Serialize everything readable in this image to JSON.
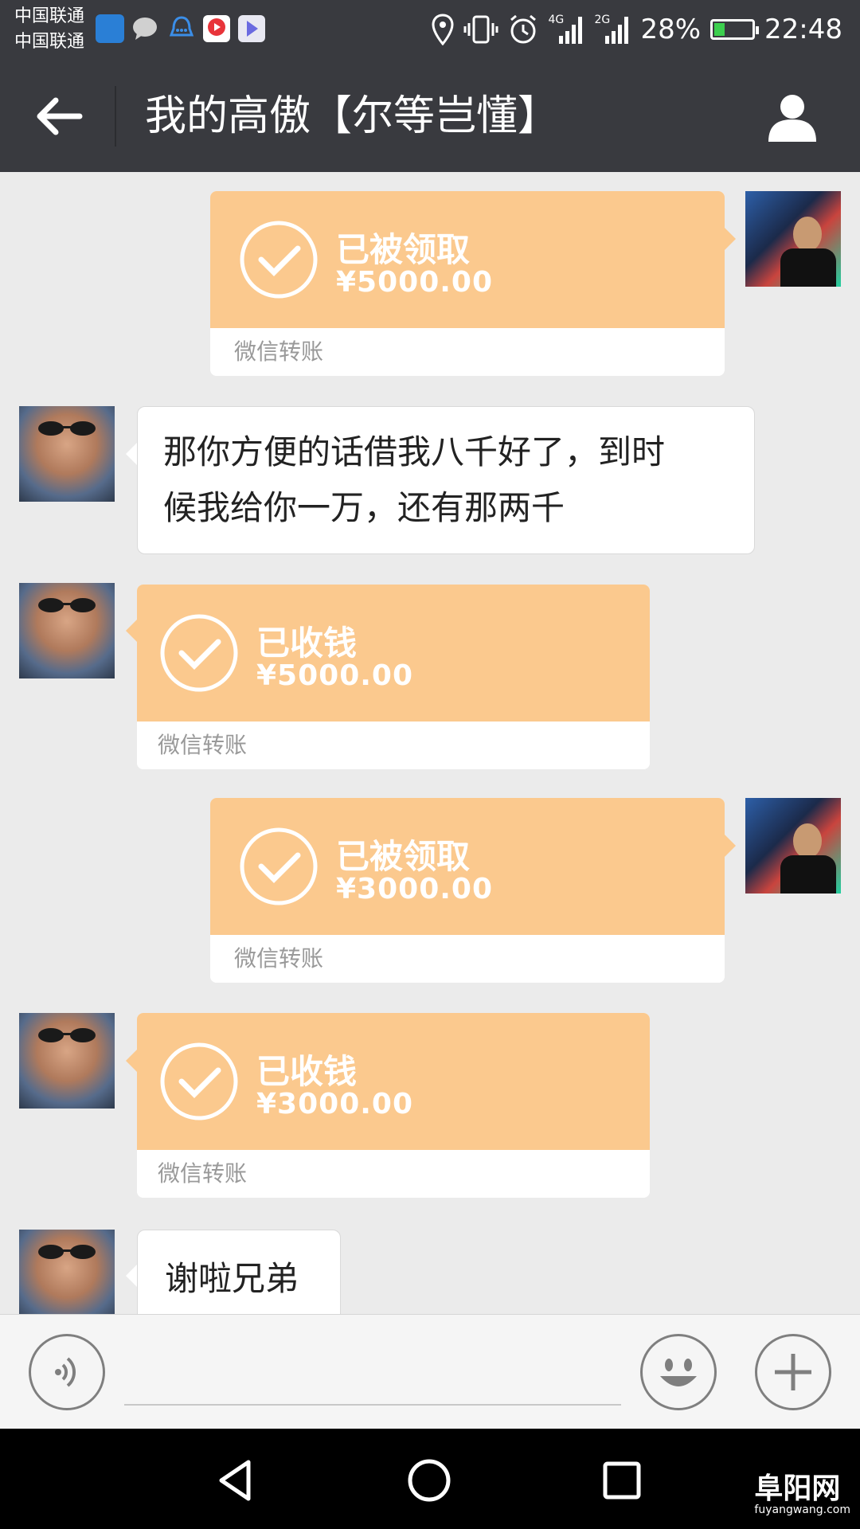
{
  "status_bar": {
    "carrier_1": "中国联通",
    "carrier_2": "中国联通",
    "battery_level": 0.28,
    "battery_text": "28%",
    "network_1": "4G",
    "network_2": "2G",
    "time": "22:48",
    "icons": [
      "weather-app-icon",
      "message-bubble-icon",
      "qq-bell-icon",
      "video-app-icon",
      "video-app-2-icon",
      "location-icon",
      "vibrate-icon",
      "alarm-icon",
      "signal-4g-icon",
      "signal-2g-icon",
      "battery-icon"
    ]
  },
  "header": {
    "title": "我的高傲【尔等岂懂】",
    "back_icon": "arrow-left-icon",
    "profile_icon": "person-icon"
  },
  "messages": [
    {
      "sender": "self",
      "type": "transfer",
      "status": "已被领取",
      "amount": "¥5000.00",
      "footer": "微信转账"
    },
    {
      "sender": "other",
      "type": "text",
      "line1": "那你方便的话借我八千好了，到时",
      "line2": "候我给你一万，还有那两千"
    },
    {
      "sender": "other",
      "type": "transfer",
      "status": "已收钱",
      "amount": "¥5000.00",
      "footer": "微信转账"
    },
    {
      "sender": "self",
      "type": "transfer",
      "status": "已被领取",
      "amount": "¥3000.00",
      "footer": "微信转账"
    },
    {
      "sender": "other",
      "type": "transfer",
      "status": "已收钱",
      "amount": "¥3000.00",
      "footer": "微信转账"
    },
    {
      "sender": "other",
      "type": "text",
      "line1": "谢啦兄弟"
    }
  ],
  "input_bar": {
    "voice_icon": "voice-icon",
    "emoji_icon": "smiley-icon",
    "more_icon": "plus-icon"
  },
  "nav_bar": {
    "back_icon": "triangle-back-icon",
    "home_icon": "circle-home-icon",
    "recents_icon": "square-recents-icon"
  },
  "watermark": {
    "text": "阜阳网",
    "domain": "fuyangwang.com"
  },
  "colors": {
    "bar_bg": "#393a3f",
    "chat_bg": "#ebebeb",
    "transfer_orange": "#fbc98e",
    "battery_green": "#3ccf4e"
  }
}
